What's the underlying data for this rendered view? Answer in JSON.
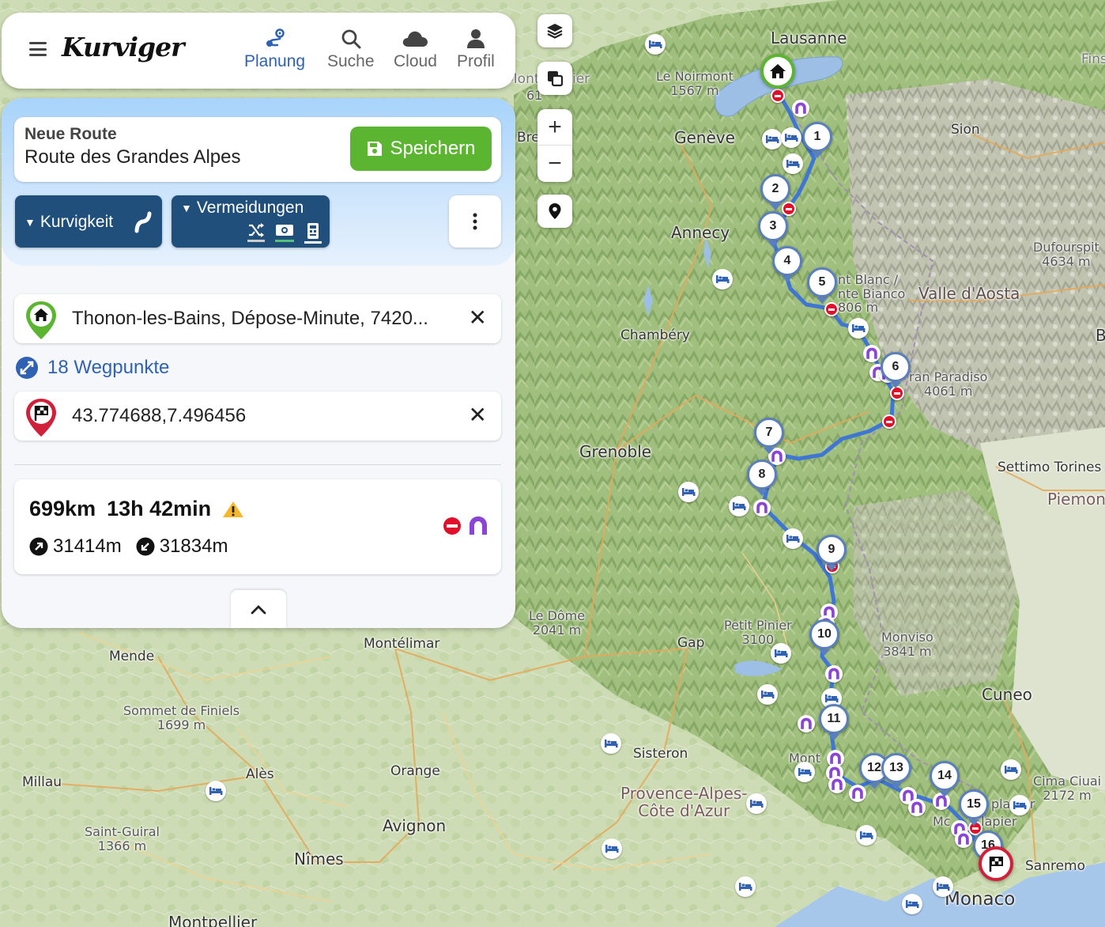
{
  "header": {
    "logo": "Kurviger",
    "nav": [
      {
        "label": "Planung",
        "icon": "planning-icon",
        "active": true
      },
      {
        "label": "Suche",
        "icon": "search-icon",
        "active": false
      },
      {
        "label": "Cloud",
        "icon": "cloud-icon",
        "active": false
      },
      {
        "label": "Profil",
        "icon": "profile-icon",
        "active": false
      }
    ]
  },
  "route": {
    "caption": "Neue Route",
    "name": "Route des Grandes Alpes",
    "save_label": "Speichern",
    "curviness_label": "Kurvigkeit",
    "avoid_label": "Vermeidungen",
    "start": "Thonon-les-Bains, Dépose-Minute, 7420...",
    "waypoints": "18 Wegpunkte",
    "destination": "43.774688,7.496456",
    "distance": "699km",
    "duration": "13h 42min",
    "ascent": "31414m",
    "descent": "31834m"
  },
  "map": {
    "labels": {
      "lausanne": "Lausanne",
      "geneve": "Genève",
      "annecy": "Annecy",
      "chambery": "Chambéry",
      "grenoble": "Grenoble",
      "sion": "Sion",
      "valle": "Valle d'Aosta",
      "settimo": "Settimo Torines",
      "piemonte": "Piemont",
      "cuneo": "Cuneo",
      "gap": "Gap",
      "sisteron": "Sisteron",
      "montelimar": "Montélimar",
      "mende": "Mende",
      "ales": "Alès",
      "orange": "Orange",
      "avignon": "Avignon",
      "nimes": "Nîmes",
      "millau": "Millau",
      "montpellier": "Montpellier",
      "provence": "Provence-Alpes-\nCôte d'Azur",
      "monaco": "Monaco",
      "sanremo": "Sanremo",
      "fins": "Fins",
      "bre": "Bre",
      "mont_left": "Mont",
      "ier": "ier",
      "b_right": "B"
    },
    "peaks": {
      "noirmont": "Le Noirmont\n1567 m",
      "montblanc": "nt Blanc /\nnte Bianco\n806 m",
      "paradiso": "ran Paradiso\n4061 m",
      "dufour": "Dufourspit\n4634 m",
      "ledome": "Le Dôme\n2041 m",
      "petitpinier": "Petit Pinier\n3100",
      "monviso": "Monviso\n3841 m",
      "sommet": "Sommet de Finiels\n1699 m",
      "saintguiral": "Saint-Guiral\n1366 m",
      "cimaciuaie": "Cima Ciuai\n2172 m",
      "mont_lat": "Mont",
      "lapier": "plapier",
      "clapier": "Clapier",
      "mc": "Mc",
      "sixtyone": "61"
    },
    "waypoint_numbers": [
      "1",
      "2",
      "3",
      "4",
      "5",
      "6",
      "7",
      "8",
      "9",
      "10",
      "11",
      "12",
      "13",
      "14",
      "15",
      "16"
    ],
    "colors": {
      "route": "#3f76d6",
      "start_marker": "#5cb531",
      "end_marker": "#d0203a",
      "accent": "#2f62b3"
    }
  }
}
